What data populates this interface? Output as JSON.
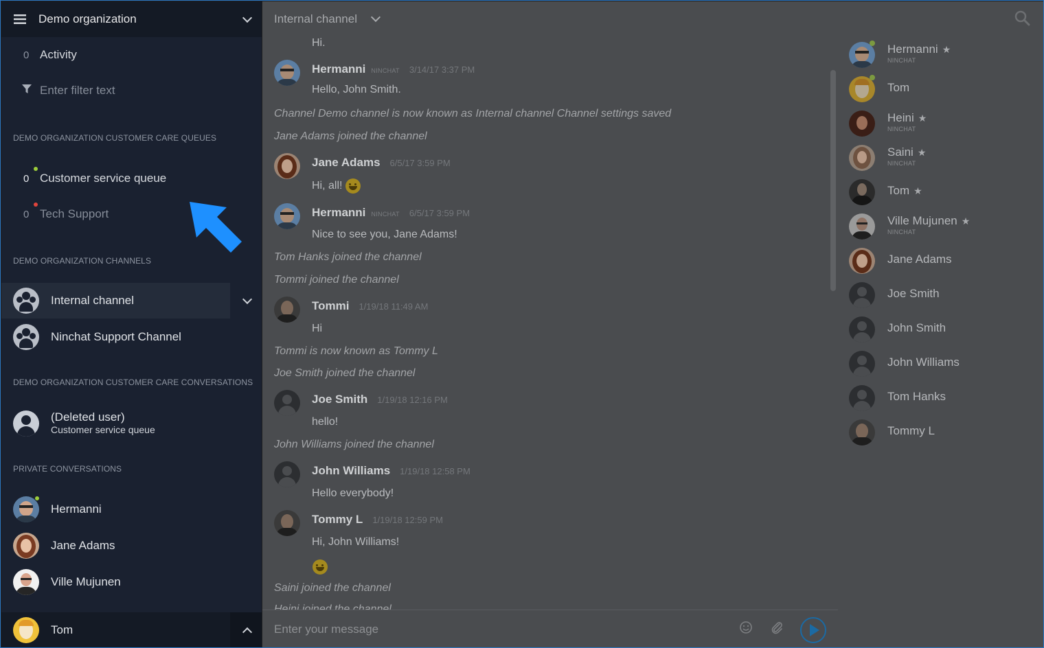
{
  "sidebar": {
    "org_title": "Demo organization",
    "activity": {
      "count": "0",
      "label": "Activity"
    },
    "filter_placeholder": "Enter filter text",
    "queues_heading": "DEMO ORGANIZATION CUSTOMER CARE QUEUES",
    "queues": [
      {
        "count": "0",
        "label": "Customer service queue",
        "status_color": "#9ccc3a"
      },
      {
        "count": "0",
        "label": "Tech Support",
        "status_color": "#e0443c"
      }
    ],
    "channels_heading": "DEMO ORGANIZATION CHANNELS",
    "channels": [
      {
        "label": "Internal channel"
      },
      {
        "label": "Ninchat Support Channel"
      }
    ],
    "conversations_heading": "DEMO ORGANIZATION CUSTOMER CARE CONVERSATIONS",
    "conversation": {
      "name": "(Deleted user)",
      "queue": "Customer service queue"
    },
    "private_heading": "PRIVATE CONVERSATIONS",
    "private": [
      {
        "label": "Hermanni"
      },
      {
        "label": "Jane Adams"
      },
      {
        "label": "Ville Mujunen"
      }
    ],
    "current_user": "Tom"
  },
  "chat": {
    "channel_title": "Internal channel",
    "composer_placeholder": "Enter your message",
    "messages": [
      {
        "kind": "text",
        "text": "Hi."
      },
      {
        "kind": "user",
        "name": "Hermanni",
        "tag": "NINCHAT",
        "time": "3/14/17 3:37 PM",
        "text": "Hello, John Smith."
      },
      {
        "kind": "system",
        "text": "Channel Demo channel is now known as Internal channel Channel settings saved"
      },
      {
        "kind": "system",
        "text": "Jane Adams joined the channel"
      },
      {
        "kind": "user",
        "name": "Jane Adams",
        "tag": "",
        "time": "6/5/17 3:59 PM",
        "text": "Hi, all!"
      },
      {
        "kind": "user",
        "name": "Hermanni",
        "tag": "NINCHAT",
        "time": "6/5/17 3:59 PM",
        "text": "Nice to see you, Jane Adams!"
      },
      {
        "kind": "system",
        "text": "Tom Hanks joined the channel"
      },
      {
        "kind": "system",
        "text": "Tommi joined the channel"
      },
      {
        "kind": "user",
        "name": "Tommi",
        "tag": "",
        "time": "1/19/18 11:49 AM",
        "text": "Hi"
      },
      {
        "kind": "system",
        "text": "Tommi is now known as Tommy L"
      },
      {
        "kind": "system",
        "text": "Joe Smith joined the channel"
      },
      {
        "kind": "user",
        "name": "Joe Smith",
        "tag": "",
        "time": "1/19/18 12:16 PM",
        "text": "hello!"
      },
      {
        "kind": "system",
        "text": "John Williams joined the channel"
      },
      {
        "kind": "user",
        "name": "John Williams",
        "tag": "",
        "time": "1/19/18 12:58 PM",
        "text": "Hello everybody!"
      },
      {
        "kind": "user",
        "name": "Tommy L",
        "tag": "",
        "time": "1/19/18 12:59 PM",
        "text": "Hi, John Williams!"
      },
      {
        "kind": "system",
        "text": "Saini joined the channel"
      },
      {
        "kind": "system",
        "text": "Heini joined the channel"
      }
    ]
  },
  "members": [
    {
      "name": "Hermanni",
      "tag": "NINCHAT",
      "star": "★",
      "online": true
    },
    {
      "name": "Tom",
      "tag": "",
      "star": "",
      "online": true
    },
    {
      "name": "Heini",
      "tag": "NINCHAT",
      "star": "★",
      "online": false
    },
    {
      "name": "Saini",
      "tag": "NINCHAT",
      "star": "★",
      "online": false
    },
    {
      "name": "Tom",
      "tag": "",
      "star": "★",
      "online": false
    },
    {
      "name": "Ville Mujunen",
      "tag": "NINCHAT",
      "star": "★",
      "online": false
    },
    {
      "name": "Jane Adams",
      "tag": "",
      "star": "",
      "online": false
    },
    {
      "name": "Joe Smith",
      "tag": "",
      "star": "",
      "online": false
    },
    {
      "name": "John Smith",
      "tag": "",
      "star": "",
      "online": false
    },
    {
      "name": "John Williams",
      "tag": "",
      "star": "",
      "online": false
    },
    {
      "name": "Tom Hanks",
      "tag": "",
      "star": "",
      "online": false
    },
    {
      "name": "Tommy L",
      "tag": "",
      "star": "",
      "online": false
    }
  ],
  "colors": {
    "accent": "#1e90ff",
    "sidebar_bg": "#1a2130",
    "online": "#9ccc3a",
    "offline_alert": "#e0443c"
  }
}
